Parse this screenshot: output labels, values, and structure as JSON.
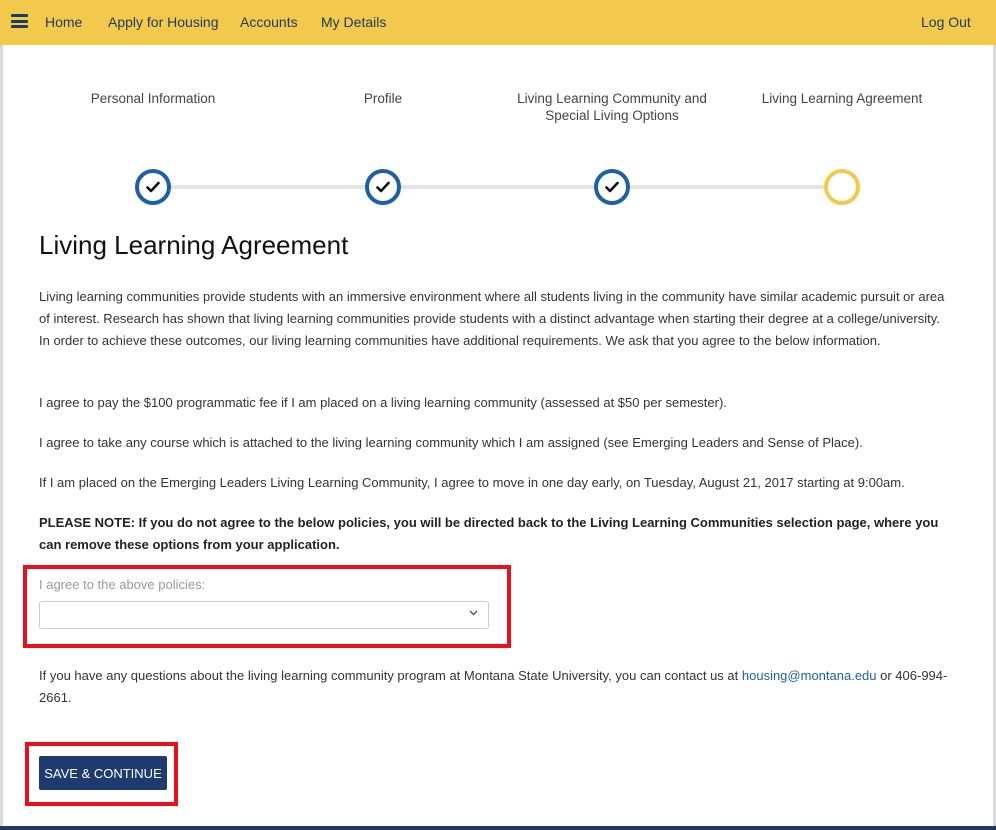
{
  "nav": {
    "home": "Home",
    "apply": "Apply for Housing",
    "accounts": "Accounts",
    "details": "My Details",
    "logout": "Log Out"
  },
  "steps": [
    {
      "label": "Personal Information",
      "status": "complete"
    },
    {
      "label": "Profile",
      "status": "complete"
    },
    {
      "label_line1": "Living Learning Community and",
      "label_line2": "Special Living Options",
      "status": "complete"
    },
    {
      "label": "Living Learning Agreement",
      "status": "current"
    }
  ],
  "check_glyph": "✔",
  "page_title": "Living Learning Agreement",
  "paragraphs": {
    "intro": "Living learning communities provide students with an immersive environment where all students living in the community have similar academic pursuit or area of interest. Research has shown that living learning communities provide students with a distinct advantage when starting their degree at a college/university. In order to achieve these outcomes, our living learning communities have additional requirements. We ask that you agree to the below information.",
    "fee": "I agree to pay the $100 programmatic fee if I am placed on a living learning community (assessed at $50 per semester).",
    "course": "I agree to take any course which is attached to the living learning community which I am assigned (see Emerging Leaders and Sense of Place).",
    "early": "If I am placed on the Emerging Leaders Living Learning Community, I agree to move in one day early, on Tuesday, August 21, 2017 starting at 9:00am.",
    "note": "PLEASE NOTE: If you do not agree to the below policies, you will be directed back to the Living Learning Communities selection page, where you can remove these options from your application.",
    "contact_before": "If you have any questions about the living learning community program at Montana State University, you can contact us at ",
    "contact_email": "housing@montana.edu",
    "contact_after": " or 406-994-2661."
  },
  "agree_field": {
    "label": "I agree to the above policies:",
    "value": "",
    "chevron": "⌄"
  },
  "save_button": "SAVE & CONTINUE",
  "colors": {
    "nav_bg": "#f2c94c",
    "complete": "#1f5fa6",
    "current": "#f2c94c",
    "button": "#1e3a6f",
    "highlight": "#e8101b"
  }
}
